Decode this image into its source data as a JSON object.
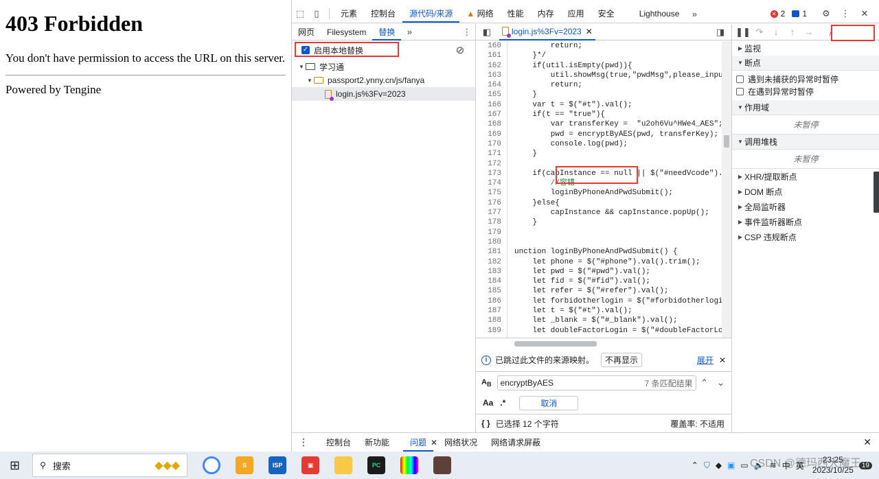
{
  "webpage": {
    "title": "403 Forbidden",
    "message": "You don't have permission to access the URL on this server.",
    "footer": "Powered by Tengine"
  },
  "devtools": {
    "main_tabs": [
      "元素",
      "控制台",
      "源代码/来源",
      "网络",
      "性能",
      "内存",
      "应用",
      "安全",
      "Lighthouse"
    ],
    "error_count": "2",
    "issue_count": "1",
    "left_tabs": [
      "网页",
      "Filesystem",
      "替换"
    ],
    "overrides_label": "启用本地替换",
    "tree": [
      "学习通",
      "passport2.ynny.cn/js/fanya",
      "login.js%3Fv=2023"
    ],
    "file_tab": "login.js%3Fv=2023",
    "line_numbers": [
      "160",
      "161",
      "162",
      "163",
      "164",
      "165",
      "166",
      "167",
      "168",
      "169",
      "170",
      "171",
      "172",
      "173",
      "174",
      "175",
      "176",
      "177",
      "178",
      "179",
      "180",
      "181",
      "182",
      "183",
      "184",
      "185",
      "186",
      "187",
      "188",
      "189"
    ],
    "code": [
      "        return;",
      "    }*/",
      "    if(util.isEmpty(pwd)){",
      "        util.showMsg(true,\"pwdMsg\",please_input",
      "        return;",
      "    }",
      "    var t = $(\"#t\").val();",
      "    if(t == \"true\"){",
      "        var transferKey =  \"u2oh6Vu^HWe4_AES\";",
      "        pwd = encryptByAES(pwd, transferKey);",
      "        console.log(pwd);",
      "    }",
      "",
      "    if(capInstance == null || $(\"#needVcode\").",
      "        //容错",
      "        loginByPhoneAndPwdSubmit();",
      "    }else{",
      "        capInstance && capInstance.popUp();",
      "    }",
      "",
      "",
      "unction loginByPhoneAndPwdSubmit() {",
      "    let phone = $(\"#phone\").val().trim();",
      "    let pwd = $(\"#pwd\").val();",
      "    let fid = $(\"#fid\").val();",
      "    let refer = $(\"#refer\").val();",
      "    let forbidotherlogin = $(\"#forbidotherlogi",
      "    let t = $(\"#t\").val();",
      "    let _blank = $(\"#_blank\").val();",
      "    let doubleFactorLogin = $(\"#doubleFactorLo"
    ],
    "info_text": "已跳过此文件的来源映射。",
    "info_btn": "不再显示",
    "info_link": "展开",
    "search_value": "encryptByAES",
    "search_result": "7 条匹配结果",
    "case_label": "Aa",
    "regex_label": ".*",
    "cancel_label": "取消",
    "status_left": "已选择 12 个字符",
    "status_right": "覆盖率: 不适用",
    "right_sections": {
      "watch": "监视",
      "breakpoints": "断点",
      "pause_uncaught": "遇到未捕获的异常时暂停",
      "pause_caught": "在遇到异常时暂停",
      "scope": "作用域",
      "not_paused": "未暂停",
      "callstack": "调用堆栈",
      "xhr": "XHR/提取断点",
      "dom": "DOM 断点",
      "global": "全局监听器",
      "event": "事件监听器断点",
      "csp": "CSP 违规断点"
    },
    "bottom_tabs": [
      "控制台",
      "新功能",
      "问题",
      "网络状况",
      "网络请求屏蔽"
    ]
  },
  "taskbar": {
    "search": "搜索",
    "time": "23:25",
    "date": "2023/10/25",
    "lang": "中",
    "ime": "英",
    "notif": "19",
    "watermark": "CSDN @德玛西大魔王"
  },
  "colors": {
    "accent": "#0b57d0",
    "highlight": "#e53935"
  }
}
